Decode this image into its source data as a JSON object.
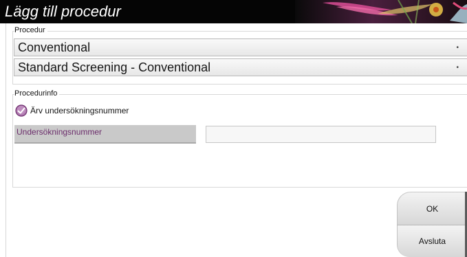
{
  "dialog": {
    "title": "Lägg till procedur"
  },
  "procedure_group": {
    "label": "Procedur",
    "procedure_select": {
      "value": "Conventional"
    },
    "standard_select": {
      "value": "Standard Screening - Conventional"
    }
  },
  "procedure_info_group": {
    "label": "Procedurinfo",
    "inherit_checkbox": {
      "label": "Ärv undersökningsnummer",
      "checked": true
    },
    "exam_number": {
      "label": "Undersökningsnummer",
      "value": ""
    }
  },
  "buttons": {
    "ok_label": "OK",
    "cancel_label": "Avsluta"
  },
  "colors": {
    "title_bar": "#050505",
    "accent_purple": "#8a3c8a"
  }
}
